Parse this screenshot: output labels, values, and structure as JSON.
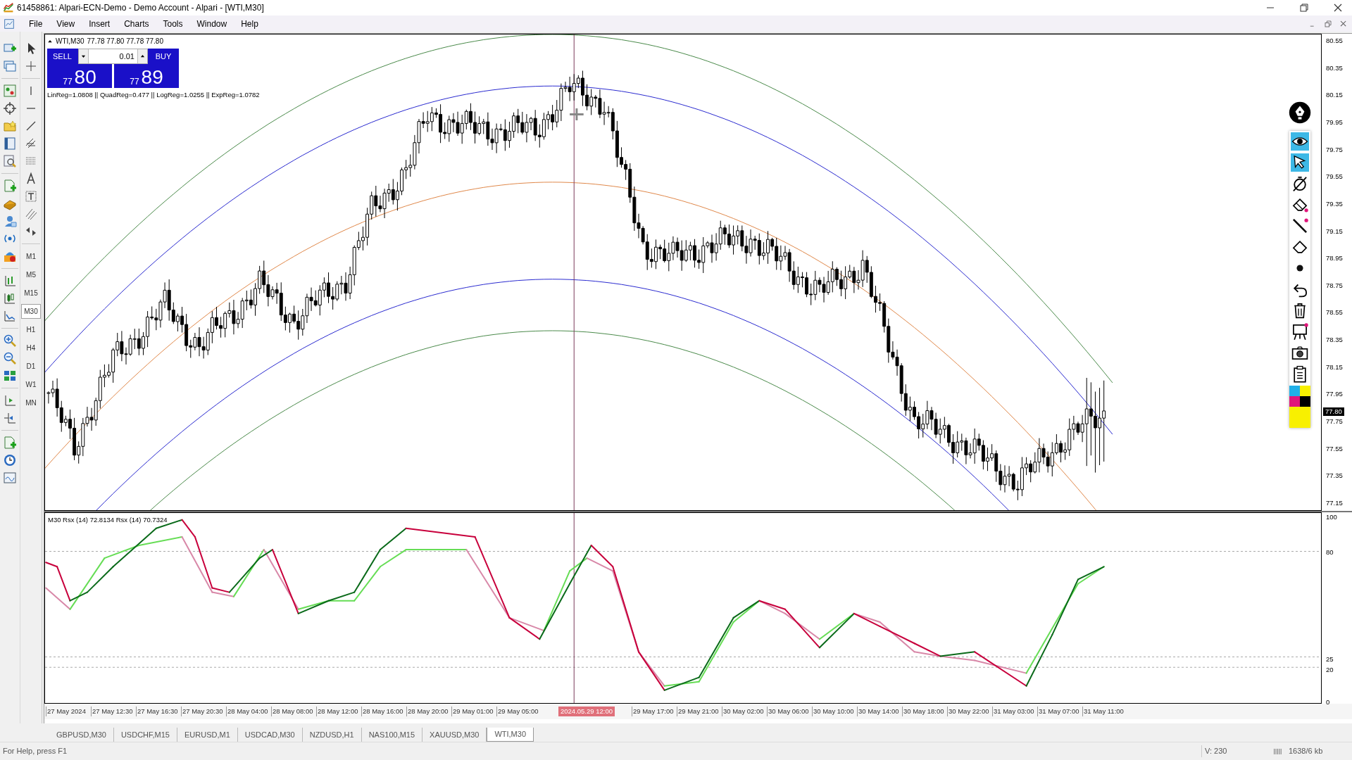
{
  "window": {
    "title": "61458861: Alpari-ECN-Demo - Demo Account - Alpari - [WTI,M30]"
  },
  "menu": [
    "File",
    "View",
    "Insert",
    "Charts",
    "Tools",
    "Window",
    "Help"
  ],
  "timeframes": [
    {
      "label": "M1",
      "selected": false
    },
    {
      "label": "M5",
      "selected": false
    },
    {
      "label": "M15",
      "selected": false
    },
    {
      "label": "M30",
      "selected": true
    },
    {
      "label": "H1",
      "selected": false
    },
    {
      "label": "H4",
      "selected": false
    },
    {
      "label": "D1",
      "selected": false
    },
    {
      "label": "W1",
      "selected": false
    },
    {
      "label": "MN",
      "selected": false
    }
  ],
  "chart": {
    "symbol": "WTI,M30",
    "ohlc": "77.78 77.80 77.78 77.80",
    "trade_panel": {
      "sell_label": "SELL",
      "buy_label": "BUY",
      "lot": "0.01",
      "sell_small": "77",
      "sell_big": "80",
      "buy_small": "77",
      "buy_big": "89"
    },
    "regression": "LinReg=1.0808 || QuadReg=0.477 || LogReg=1.0255 || ExpReg=1.0782",
    "price_axis": [
      "80.55",
      "80.35",
      "80.15",
      "79.95",
      "79.75",
      "79.55",
      "79.35",
      "79.15",
      "78.95",
      "78.75",
      "78.55",
      "78.35",
      "78.15",
      "77.95",
      "77.75",
      "77.55",
      "77.35",
      "77.15"
    ],
    "current_price": "77.80"
  },
  "indicator": {
    "header": "M30 Rsx (14) 72.8134 Rsx (14) 70.7324",
    "axis": [
      "100",
      "80",
      "25",
      "20",
      "0"
    ]
  },
  "time_axis": [
    {
      "kind": "tick",
      "text": "27 May 2024"
    },
    {
      "kind": "tick",
      "text": "27 May 12:30"
    },
    {
      "kind": "tick",
      "text": "27 May 16:30"
    },
    {
      "kind": "tick",
      "text": "27 May 20:30"
    },
    {
      "kind": "tick",
      "text": "28 May 04:00"
    },
    {
      "kind": "tick",
      "text": "28 May 08:00"
    },
    {
      "kind": "tick",
      "text": "28 May 12:00"
    },
    {
      "kind": "tick",
      "text": "28 May 16:00"
    },
    {
      "kind": "tick",
      "text": "28 May 20:00"
    },
    {
      "kind": "tick",
      "text": "29 May 01:00"
    },
    {
      "kind": "tick",
      "text": "29 May 05:00"
    },
    {
      "kind": "crosshair",
      "text": "2024.05.29 12:00"
    },
    {
      "kind": "tick",
      "text": "29 May 17:00"
    },
    {
      "kind": "tick",
      "text": "29 May 21:00"
    },
    {
      "kind": "tick",
      "text": "30 May 02:00"
    },
    {
      "kind": "tick",
      "text": "30 May 06:00"
    },
    {
      "kind": "tick",
      "text": "30 May 10:00"
    },
    {
      "kind": "tick",
      "text": "30 May 14:00"
    },
    {
      "kind": "tick",
      "text": "30 May 18:00"
    },
    {
      "kind": "tick",
      "text": "30 May 22:00"
    },
    {
      "kind": "tick",
      "text": "31 May 03:00"
    },
    {
      "kind": "tick",
      "text": "31 May 07:00"
    },
    {
      "kind": "tick",
      "text": "31 May 11:00"
    }
  ],
  "tabs": [
    {
      "label": "GBPUSD,M30",
      "selected": false
    },
    {
      "label": "USDCHF,M15",
      "selected": false
    },
    {
      "label": "EURUSD,M1",
      "selected": false
    },
    {
      "label": "USDCAD,M30",
      "selected": false
    },
    {
      "label": "NZDUSD,H1",
      "selected": false
    },
    {
      "label": "NAS100,M15",
      "selected": false
    },
    {
      "label": "XAUUSD,M30",
      "selected": false
    },
    {
      "label": "WTI,M30",
      "selected": true
    }
  ],
  "status_bar": {
    "help": "For Help, press F1",
    "volume": "V: 230",
    "traffic": "1638/6 kb"
  }
}
